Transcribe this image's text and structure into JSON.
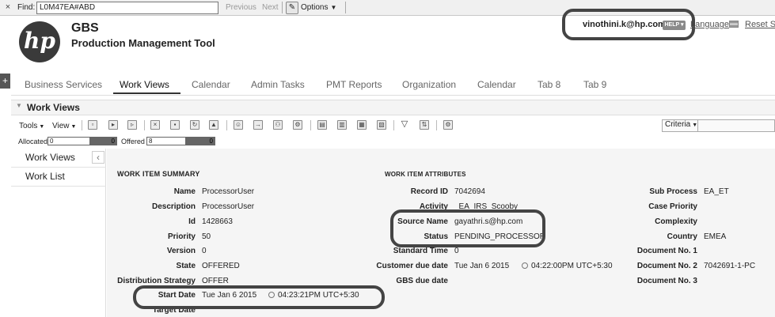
{
  "findbar": {
    "close_glyph": "×",
    "find_label": "Find:",
    "find_value": "L0M47EA#ABD",
    "previous_label": "Previous",
    "next_label": "Next",
    "options_label": "Options",
    "options_icon": "pencil-icon"
  },
  "header": {
    "logo_text": "hp",
    "title": "GBS",
    "subtitle": "Production Management Tool",
    "user_email": "vinothini.k@hp.com",
    "help_label": "HELP",
    "language_label": "Language",
    "reset_label": "Reset Se"
  },
  "side_toggle": "+",
  "tabs": [
    {
      "label": "Business Services",
      "active": false
    },
    {
      "label": "Work Views",
      "active": true
    },
    {
      "label": "Calendar",
      "active": false
    },
    {
      "label": "Admin Tasks",
      "active": false
    },
    {
      "label": "PMT Reports",
      "active": false
    },
    {
      "label": "Organization",
      "active": false
    },
    {
      "label": "Calendar",
      "active": false
    },
    {
      "label": "Tab 8",
      "active": false
    },
    {
      "label": "Tab 9",
      "active": false
    }
  ],
  "portlet": {
    "title": "Work Views"
  },
  "toolbar": {
    "tools_label": "Tools",
    "view_label": "View",
    "criteria_label": "Criteria"
  },
  "counters": {
    "allocated_label": "Allocated",
    "allocated_value": "0",
    "allocated_max": "0",
    "offered_label": "Offered",
    "offered_value": "8",
    "offered_max": "0"
  },
  "leftnav": {
    "items": [
      "Work Views",
      "Work List"
    ],
    "collapse_glyph": "‹"
  },
  "summary": {
    "title": "WORK ITEM SUMMARY",
    "fields": [
      {
        "label": "Name",
        "value": "ProcessorUser"
      },
      {
        "label": "Description",
        "value": "ProcessorUser"
      },
      {
        "label": "Id",
        "value": "1428663"
      },
      {
        "label": "Priority",
        "value": "50"
      },
      {
        "label": "Version",
        "value": "0"
      },
      {
        "label": "State",
        "value": "OFFERED"
      },
      {
        "label": "Distribution Strategy",
        "value": "OFFER"
      },
      {
        "label": "Start Date",
        "value": "Tue Jan 6 2015",
        "time": "04:23:21PM UTC+5:30"
      },
      {
        "label": "Target Date",
        "value": ""
      }
    ]
  },
  "attributes": {
    "title": "WORK ITEM ATTRIBUTES",
    "fields": [
      {
        "label": "Record ID",
        "value": "7042694"
      },
      {
        "label": "Activity",
        "value": "_EA_IRS_Scooby"
      },
      {
        "label": "Source Name",
        "value": "gayathri.s@hp.com"
      },
      {
        "label": "Status",
        "value": "PENDING_PROCESSOR"
      },
      {
        "label": "Standard Time",
        "value": "0"
      },
      {
        "label": "Customer due date",
        "value": "Tue Jan 6 2015",
        "time": "04:22:00PM UTC+5:30"
      },
      {
        "label": "GBS due date",
        "value": ""
      }
    ]
  },
  "extra": {
    "fields": [
      {
        "label": "Sub Process",
        "value": "EA_ET"
      },
      {
        "label": "Case Priority",
        "value": ""
      },
      {
        "label": "Complexity",
        "value": ""
      },
      {
        "label": "Country",
        "value": "EMEA"
      },
      {
        "label": "Document No. 1",
        "value": ""
      },
      {
        "label": "Document No. 2",
        "value": "7042691-1-PC"
      },
      {
        "label": "Document No. 3",
        "value": ""
      }
    ]
  }
}
